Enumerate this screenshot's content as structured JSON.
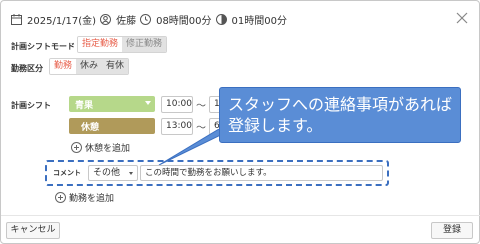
{
  "header": {
    "date": "2025/1/17(金)",
    "person": "佐藤",
    "work_time": "08時間00分",
    "break_time": "01時間00分"
  },
  "plan_shift_mode": {
    "label": "計画シフトモード",
    "options": [
      "指定勤務",
      "修正勤務"
    ],
    "selected": "指定勤務"
  },
  "work_type": {
    "label": "勤務区分",
    "options": [
      "勤務",
      "休み",
      "有休"
    ],
    "selected": "勤務"
  },
  "plan_shift": {
    "label": "計画シフト",
    "shift_name": "青果",
    "shift_start": "10:00",
    "shift_end_partial": "1",
    "break_name": "休憩",
    "break_start": "13:00",
    "break_end_partial": "6",
    "tilde": "〜",
    "add_break_label": "休憩を追加"
  },
  "comment": {
    "label": "コメント",
    "category": "その他",
    "text": "この時間で勤務をお願いします。"
  },
  "add_work_label": "勤務を追加",
  "callout": {
    "line1": "スタッフへの連絡事項があれば",
    "line2": "登録します。"
  },
  "footer": {
    "cancel_label": "キャンセル",
    "register_label": "登録"
  },
  "colors": {
    "shift_green": "#b6d88a",
    "break_brown": "#b09a5a",
    "accent_red": "#e8604c",
    "callout_blue": "#5a8dd6",
    "highlight_blue": "#3b6fc0"
  }
}
